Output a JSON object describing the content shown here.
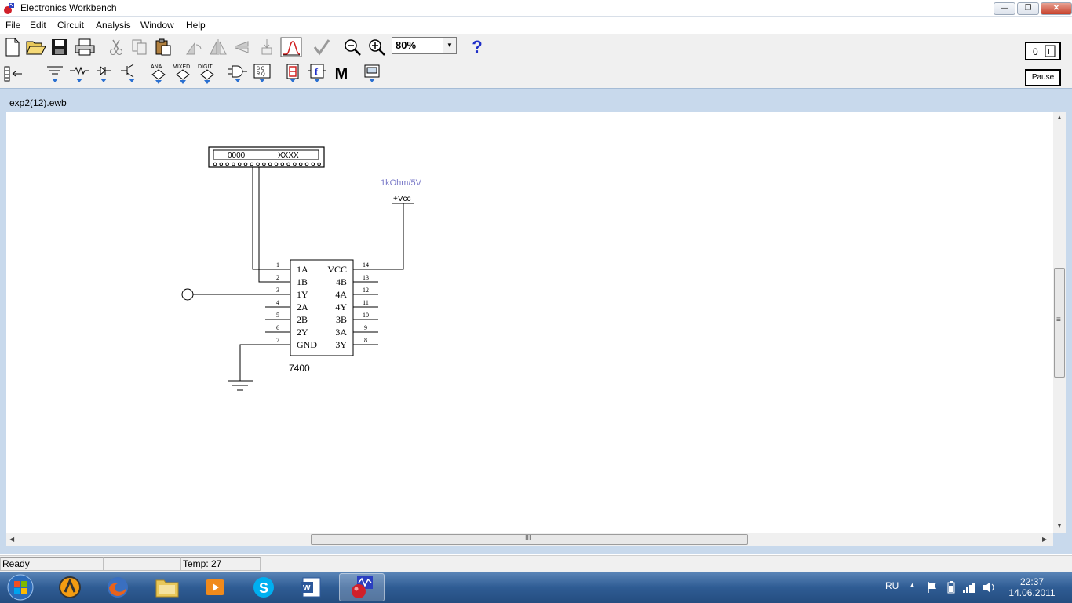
{
  "window": {
    "title": "Electronics Workbench",
    "minimize": "—",
    "maximize": "❐",
    "close": "✕"
  },
  "menu": [
    "File",
    "Edit",
    "Circuit",
    "Analysis",
    "Window",
    "Help"
  ],
  "toolbar": {
    "zoom_value": "80%",
    "help_glyph": "?",
    "pause_label": "Pause",
    "m_glyph": "M",
    "f_glyph": "f",
    "ana_label": "ANA",
    "mixed_label": "MIXED",
    "digit_label": "DIGIT"
  },
  "document": {
    "tab_title": "exp2(12).ewb"
  },
  "circuit": {
    "word_generator": {
      "left": "0000",
      "right": "XXXX"
    },
    "vcc_annotation": "1kOhm/5V",
    "vcc_label": "+Vcc",
    "chip": {
      "name": "7400",
      "left_pins": [
        {
          "num": "1",
          "label": "1A"
        },
        {
          "num": "2",
          "label": "1B"
        },
        {
          "num": "3",
          "label": "1Y"
        },
        {
          "num": "4",
          "label": "2A"
        },
        {
          "num": "5",
          "label": "2B"
        },
        {
          "num": "6",
          "label": "2Y"
        },
        {
          "num": "7",
          "label": "GND"
        }
      ],
      "right_pins": [
        {
          "num": "14",
          "label": "VCC"
        },
        {
          "num": "13",
          "label": "4B"
        },
        {
          "num": "12",
          "label": "4A"
        },
        {
          "num": "11",
          "label": "4Y"
        },
        {
          "num": "10",
          "label": "3B"
        },
        {
          "num": "9",
          "label": "3A"
        },
        {
          "num": "8",
          "label": "3Y"
        }
      ]
    }
  },
  "scroll": {
    "h_grip": "III",
    "v_grip": "≡"
  },
  "status": {
    "state": "Ready",
    "empty": "",
    "temp": "Temp:  27"
  },
  "taskbar": {
    "language": "RU",
    "time": "22:37",
    "date": "14.06.2011",
    "apps": [
      "start",
      "avast",
      "firefox",
      "explorer",
      "media-player",
      "skype",
      "word",
      "electronics-workbench"
    ]
  },
  "colors": {
    "accent_blue": "#1f2fc8",
    "annotation": "#7a7ac8",
    "frame": "#c8d9ec"
  }
}
